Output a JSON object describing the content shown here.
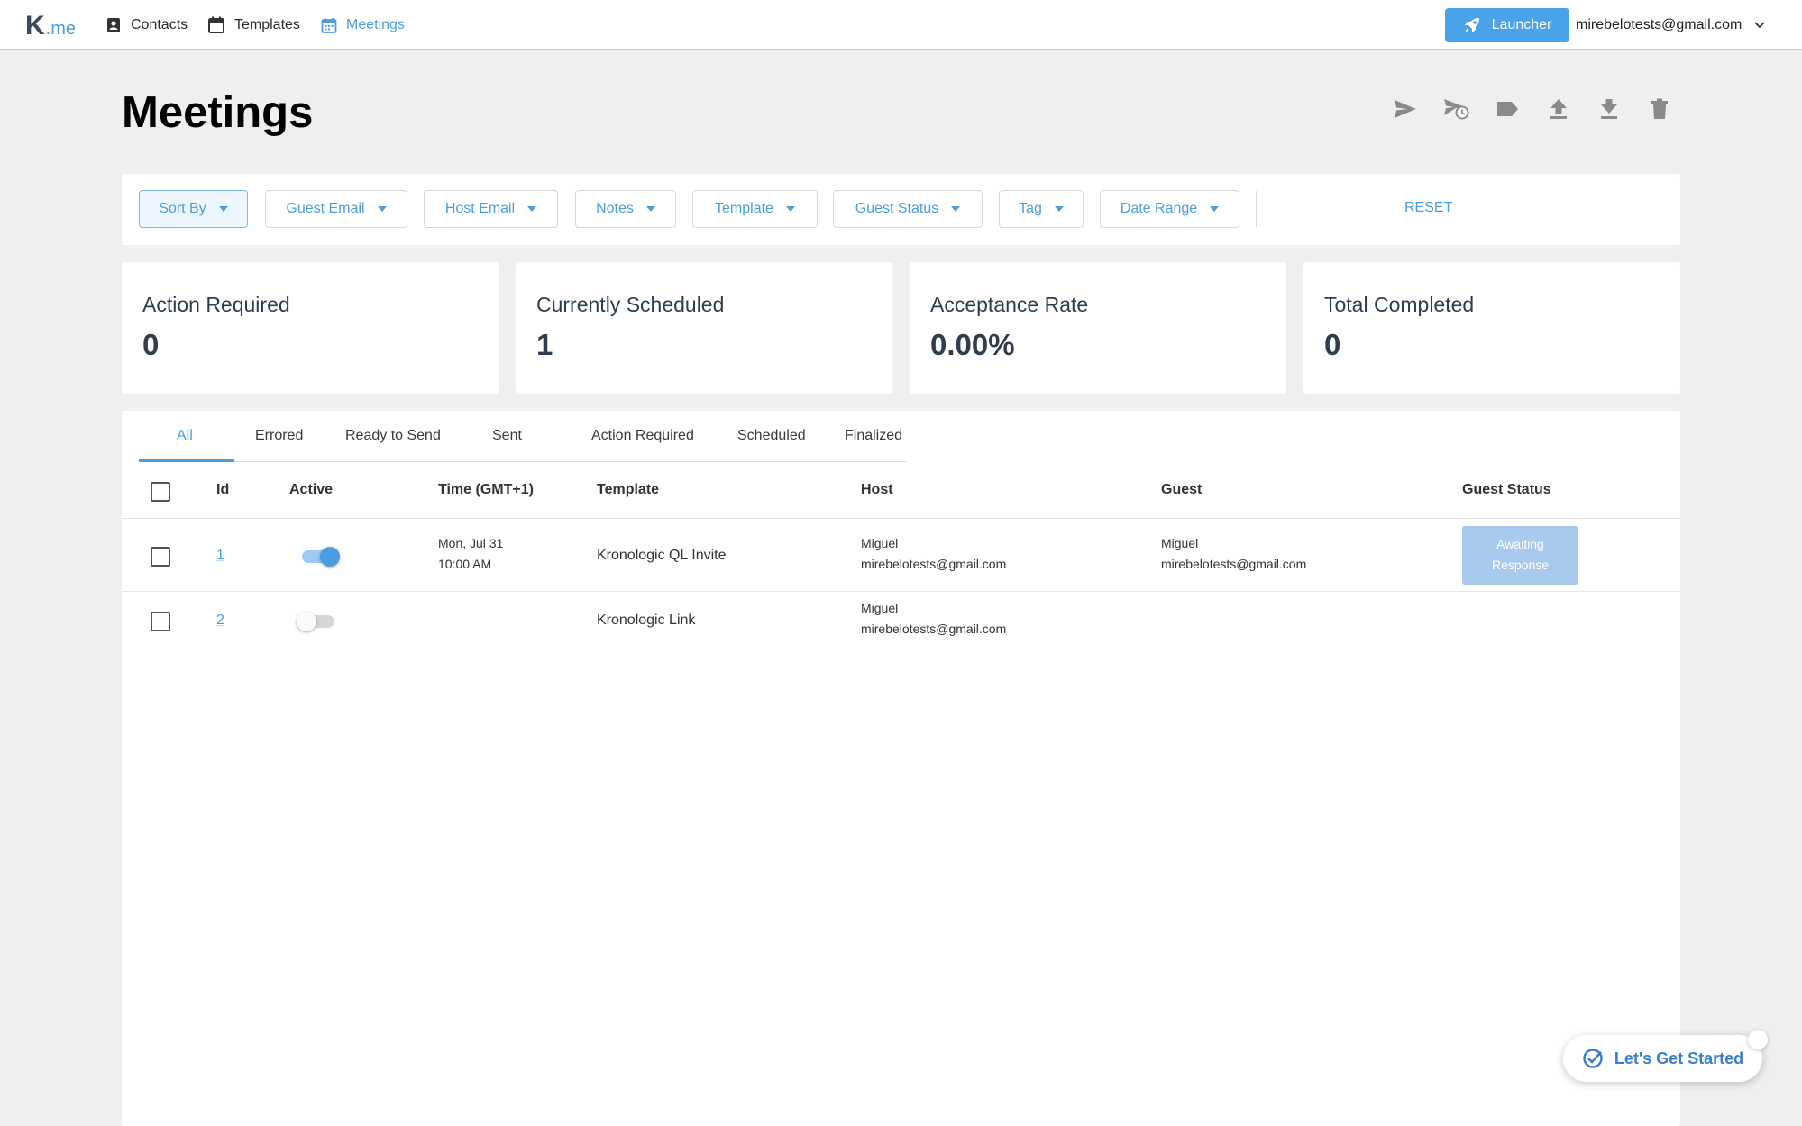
{
  "app": {
    "logo_k": "K",
    "logo_me": ".me",
    "nav": [
      {
        "label": "Contacts",
        "icon": "contact-card-icon"
      },
      {
        "label": "Templates",
        "icon": "calendar-outline-icon"
      },
      {
        "label": "Meetings",
        "icon": "calendar-grid-icon",
        "active": true
      }
    ],
    "launcher_label": "Launcher",
    "account_email": "mirebelotests@gmail.com"
  },
  "page": {
    "title": "Meetings",
    "toolbar_icons": [
      "send-icon",
      "schedule-send-icon",
      "tag-icon",
      "upload-icon",
      "download-icon",
      "delete-icon"
    ]
  },
  "filters": {
    "buttons": [
      "Sort By",
      "Guest Email",
      "Host Email",
      "Notes",
      "Template",
      "Guest Status",
      "Tag",
      "Date Range"
    ],
    "reset_label": "RESET"
  },
  "stats": [
    {
      "label": "Action Required",
      "value": "0"
    },
    {
      "label": "Currently Scheduled",
      "value": "1"
    },
    {
      "label": "Acceptance Rate",
      "value": "0.00%"
    },
    {
      "label": "Total Completed",
      "value": "0"
    }
  ],
  "tabs": [
    "All",
    "Errored",
    "Ready to Send",
    "Sent",
    "Action Required",
    "Scheduled",
    "Finalized"
  ],
  "table": {
    "columns": [
      "Id",
      "Active",
      "Time (GMT+1)",
      "Template",
      "Host",
      "Guest",
      "Guest Status"
    ],
    "rows": [
      {
        "id": "1",
        "active": true,
        "time_date": "Mon, Jul 31",
        "time_clock": "10:00 AM",
        "template": "Kronologic QL Invite",
        "host_name": "Miguel",
        "host_email": "mirebelotests@gmail.com",
        "guest_name": "Miguel",
        "guest_email": "mirebelotests@gmail.com",
        "status_line1": "Awaiting",
        "status_line2": "Response"
      },
      {
        "id": "2",
        "active": false,
        "template": "Kronologic Link",
        "host_name": "Miguel",
        "host_email": "mirebelotests@gmail.com"
      }
    ]
  },
  "help": {
    "label": "Let's Get Started"
  },
  "colors": {
    "accent": "#4a9de0",
    "launcher": "#4aa3e8",
    "badge": "#a9c9ef",
    "background": "#efefef"
  }
}
